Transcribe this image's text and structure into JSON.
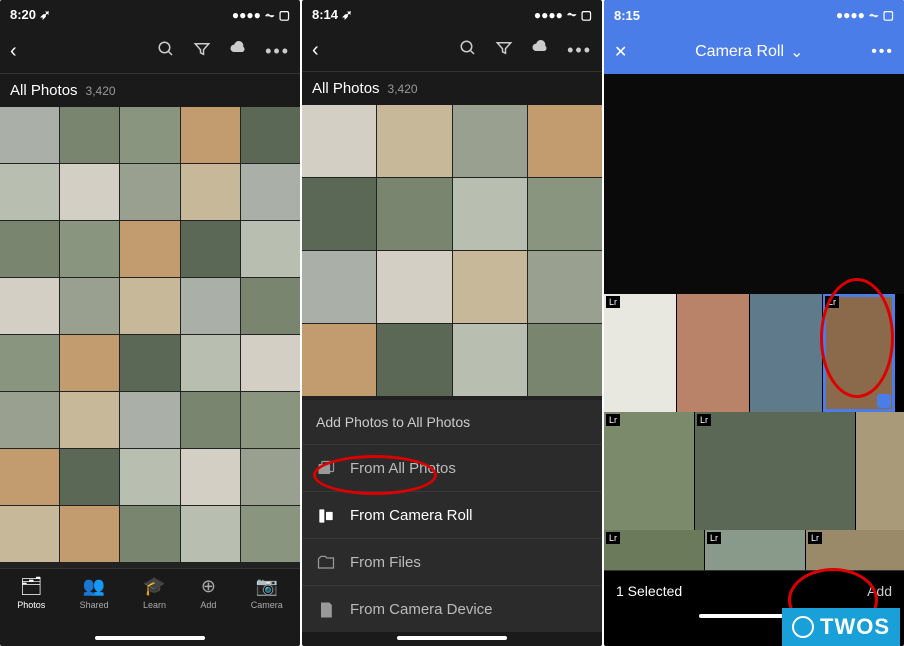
{
  "phone1": {
    "status": {
      "time": "8:20",
      "loc": "➶",
      "signal": "●●●●",
      "wifi": "⏦",
      "battery": "▢"
    },
    "nav": {
      "back": "‹"
    },
    "title": {
      "main": "All Photos",
      "count": "3,420"
    },
    "tabs": {
      "photos": {
        "label": "Photos",
        "icon": "🗂"
      },
      "shared": {
        "label": "Shared",
        "icon": "👥"
      },
      "learn": {
        "label": "Learn",
        "icon": "🎓"
      },
      "add": {
        "label": "Add",
        "icon": "⊕"
      },
      "camera": {
        "label": "Camera",
        "icon": "📷"
      }
    }
  },
  "phone2": {
    "status": {
      "time": "8:14",
      "loc": "➶",
      "signal": "●●●●",
      "wifi": "⏦",
      "battery": "▢"
    },
    "nav": {
      "back": "‹"
    },
    "title": {
      "main": "All Photos",
      "count": "3,420"
    },
    "sheet": {
      "title": "Add Photos to All Photos",
      "items": [
        {
          "label": "From All Photos"
        },
        {
          "label": "From Camera Roll"
        },
        {
          "label": "From Files"
        },
        {
          "label": "From Camera Device"
        }
      ]
    }
  },
  "phone3": {
    "status": {
      "time": "8:15",
      "signal": "●●●●",
      "wifi": "⏦",
      "battery": "▢"
    },
    "nav": {
      "close": "✕",
      "title": "Camera Roll",
      "chevron": "⌄",
      "more": "•••"
    },
    "strip": {
      "lr_badge": "Lr"
    },
    "selection": {
      "label": "1 Selected",
      "add": "Add"
    }
  },
  "logo": {
    "text": "TWOS"
  }
}
